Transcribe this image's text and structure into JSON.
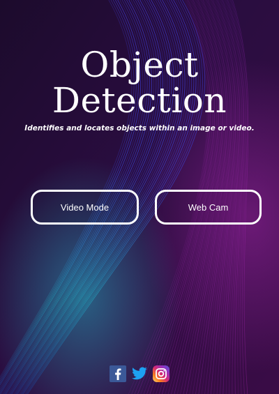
{
  "app": {
    "title_line_1": "Object",
    "title_line_2": "Detection",
    "subtitle": "Identifies and locates objects within an image or video."
  },
  "buttons": {
    "video_mode": "Video Mode",
    "web_cam": "Web Cam"
  },
  "social": {
    "icons": [
      "facebook-icon",
      "twitter-icon",
      "instagram-icon"
    ]
  },
  "colors": {
    "background_dark": "#2a0d3d",
    "wave_blue": "#3b3fe0",
    "wave_teal": "#2ec5d0",
    "wave_magenta": "#b02bb0",
    "text": "#ffffff"
  }
}
